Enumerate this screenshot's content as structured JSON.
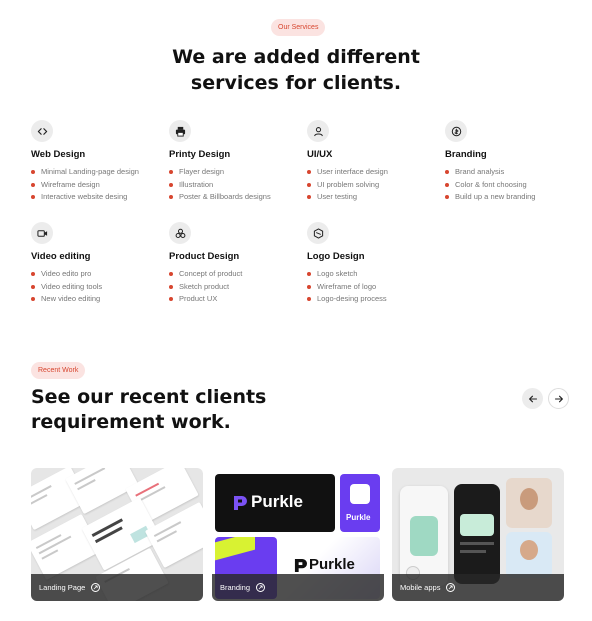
{
  "services_section": {
    "badge": "Our Services",
    "heading_line1": "We are added different",
    "heading_line2": "services for clients.",
    "items": [
      {
        "icon": "code-icon",
        "title": "Web Design",
        "bullets": [
          "Minimal Landing-page design",
          "Wireframe design",
          "Interactive website desing"
        ]
      },
      {
        "icon": "printer-icon",
        "title": "Printy Design",
        "bullets": [
          "Flayer design",
          "Illustration",
          "Poster & Billboards designs"
        ]
      },
      {
        "icon": "user-icon",
        "title": "UI/UX",
        "bullets": [
          "User interface design",
          "UI problem solving",
          "User testing"
        ]
      },
      {
        "icon": "coin-icon",
        "title": "Branding",
        "bullets": [
          "Brand analysis",
          "Color & font choosing",
          "Build up a new branding"
        ]
      },
      {
        "icon": "video-camera-icon",
        "title": "Video editing",
        "bullets": [
          "Video edito pro",
          "Video editing tools",
          "New video editing"
        ]
      },
      {
        "icon": "shapes-icon",
        "title": "Product Design",
        "bullets": [
          "Concept of product",
          "Sketch product",
          "Product UX"
        ]
      },
      {
        "icon": "hexagon-logo-icon",
        "title": "Logo Design",
        "bullets": [
          "Logo sketch",
          "Wireframe of logo",
          "Logo-desing process"
        ]
      }
    ]
  },
  "recent_section": {
    "badge": "Recent Work",
    "heading_line1": "See our recent clients",
    "heading_line2": "requirement work.",
    "prev_icon": "arrow-left-icon",
    "next_icon": "arrow-right-icon",
    "cards": [
      {
        "label": "Landing Page"
      },
      {
        "label": "Branding",
        "brand_text": "Purkle"
      },
      {
        "label": "Mobile apps"
      }
    ]
  },
  "colors": {
    "accent": "#d7462f",
    "badge_bg": "#fbe3e1",
    "icon_bg": "#ececec",
    "brand_purple": "#6a3df0",
    "brand_lime": "#d8f232"
  }
}
